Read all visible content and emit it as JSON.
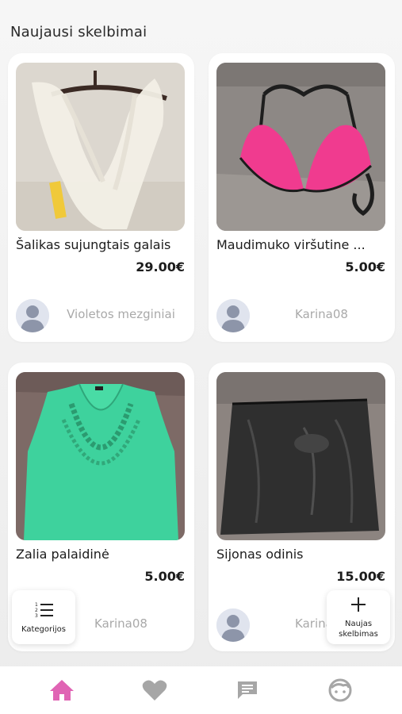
{
  "header": {
    "title": "Naujausi skelbimai"
  },
  "listings": [
    {
      "title": "Šalikas sujungtais galais",
      "price": "29.00€",
      "seller": "Violetos mezginiai"
    },
    {
      "title": "Maudimuko viršutine ...",
      "price": "5.00€",
      "seller": "Karina08"
    },
    {
      "title": "Zalia palaidinė",
      "price": "5.00€",
      "seller": "Karina08"
    },
    {
      "title": "Sijonas odinis",
      "price": "15.00€",
      "seller": "Karina08"
    }
  ],
  "fab_categories": {
    "label": "Kategorijos",
    "icon": "numbered-list-icon"
  },
  "fab_new": {
    "label": "Naujas skelbimas",
    "icon": "plus-icon"
  },
  "nav": [
    {
      "name": "home",
      "icon": "home-icon",
      "active": true
    },
    {
      "name": "favorites",
      "icon": "heart-icon",
      "active": false
    },
    {
      "name": "messages",
      "icon": "chat-icon",
      "active": false
    },
    {
      "name": "profile",
      "icon": "face-icon",
      "active": false
    }
  ],
  "colors": {
    "active_nav": "#e064b4",
    "inactive_nav": "#a6a6a6",
    "seller_text": "#a9a9a9"
  }
}
